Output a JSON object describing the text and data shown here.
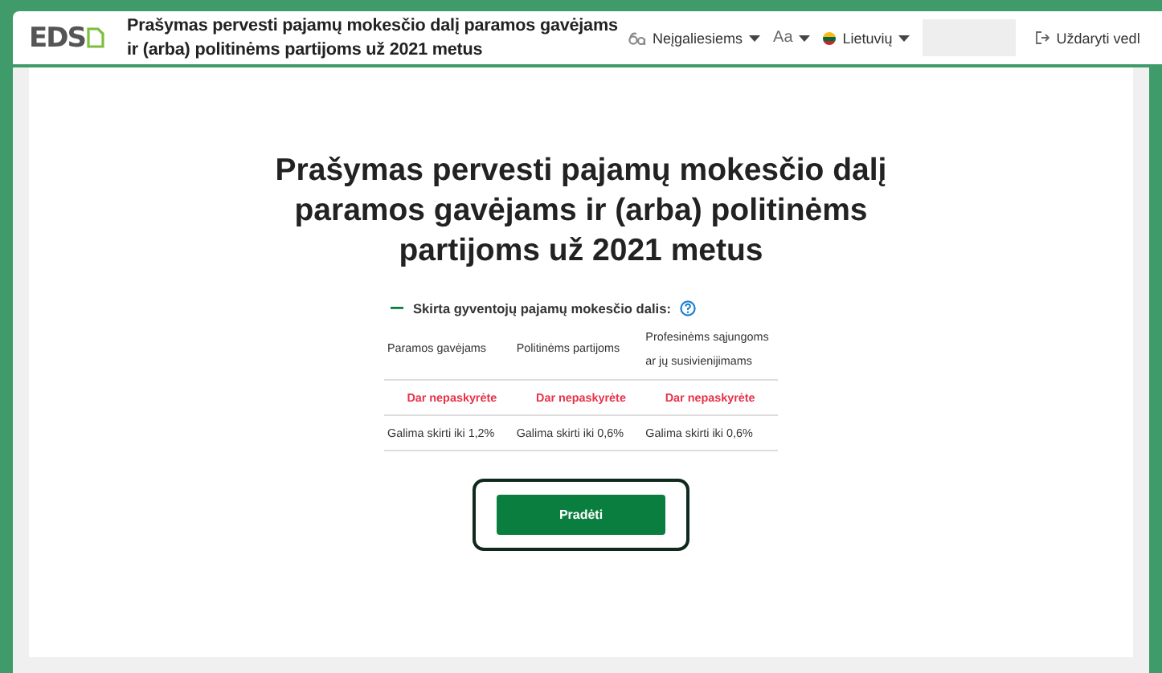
{
  "header": {
    "logo": "EDS",
    "title": "Prašymas pervesti pajamų mokesčio dalį paramos gavėjams ir (arba) politinėms partijoms už 2021 metus",
    "menus": [
      {
        "kind": "accessibility",
        "label": "Neįgaliesiems"
      },
      {
        "kind": "font",
        "label": "Aa"
      },
      {
        "kind": "language",
        "label": "Lietuvių"
      }
    ],
    "close_link": "Uždaryti vedl"
  },
  "card": {
    "title": "Prašymas pervesti pajamų mokesčio dalį paramos gavėjams ir (arba) politinėms partijoms už 2021 metus",
    "section": {
      "expanded": true,
      "heading": "Skirta gyventojų pajamų mokesčio dalis:",
      "columns": [
        "Paramos gavėjams",
        "Politinėms partijoms",
        "Profesinėms sąjungoms ar jų susivienijimams"
      ],
      "status": [
        "Dar nepaskyrėte",
        "Dar nepaskyrėte",
        "Dar nepaskyrėte"
      ],
      "limits": [
        "Galima skirti iki 1,2%",
        "Galima skirti iki 0,6%",
        "Galima skirti iki 0,6%"
      ]
    },
    "button": "Pradėti"
  }
}
